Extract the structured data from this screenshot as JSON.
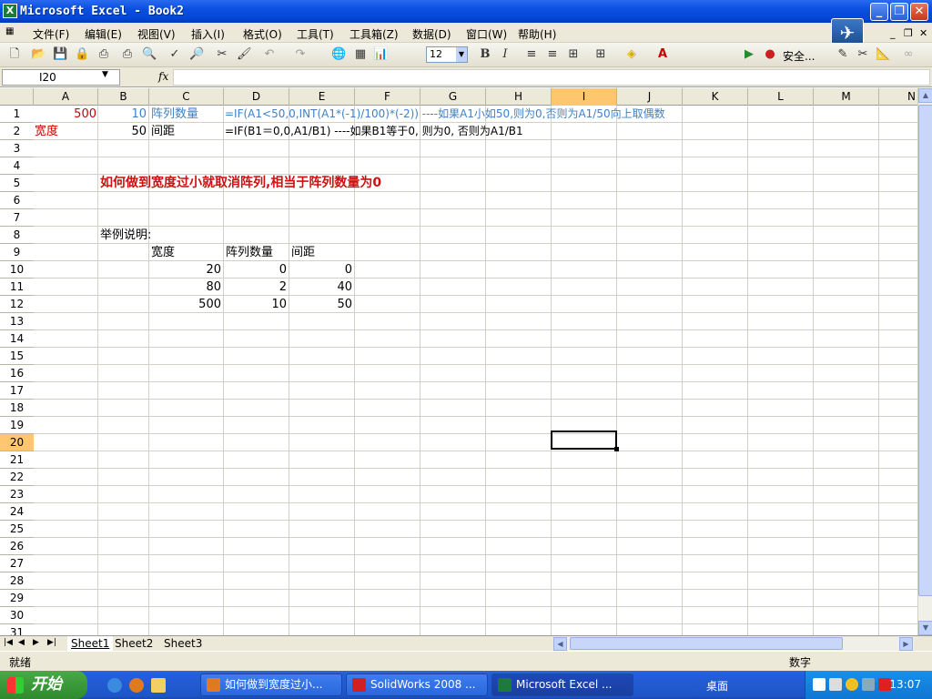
{
  "window": {
    "title": "Microsoft Excel - Book2"
  },
  "menu": [
    "文件(F)",
    "编辑(E)",
    "视图(V)",
    "插入(I)",
    "格式(O)",
    "工具(T)",
    "工具箱(Z)",
    "数据(D)",
    "窗口(W)",
    "帮助(H)"
  ],
  "toolbar": {
    "font_size": "12",
    "security_label": "安全..."
  },
  "formula_bar": {
    "name_box": "I20",
    "fx": "fx",
    "formula": ""
  },
  "columns": [
    "A",
    "B",
    "C",
    "D",
    "E",
    "F",
    "G",
    "H",
    "I",
    "J",
    "K",
    "L",
    "M",
    "N"
  ],
  "selected_column": "I",
  "selected_row": "20",
  "rows": [
    "1",
    "2",
    "3",
    "4",
    "5",
    "6",
    "7",
    "8",
    "9",
    "10",
    "11",
    "12",
    "13",
    "14",
    "15",
    "16",
    "17",
    "18",
    "19",
    "20",
    "21",
    "22",
    "23",
    "24",
    "25",
    "26",
    "27",
    "28",
    "29",
    "30",
    "31"
  ],
  "cells": {
    "a1": "500",
    "b1": "10",
    "c1": "阵列数量",
    "d1": "=IF(A1<50,0,INT(A1*(-1)/100)*(-2))   ----如果A1小如50,则为0,否则为A1/50向上取偶数",
    "a2": "宽度",
    "b2": "50",
    "c2": "间距",
    "d2": "=IF(B1＝0,0,A1/B1)    ----如果B1等于0, 则为0, 否则为A1/B1",
    "b5": "如何做到宽度过小就取消阵列,相当于阵列数量为0",
    "b8": "举例说明:",
    "c9": "宽度",
    "d9": "阵列数量",
    "e9": "间距",
    "c10": "20",
    "d10": "0",
    "e10": "0",
    "c11": "80",
    "d11": "2",
    "e11": "40",
    "c12": "500",
    "d12": "10",
    "e12": "50"
  },
  "sheets": [
    "Sheet1",
    "Sheet2",
    "Sheet3"
  ],
  "status": {
    "left": "就绪",
    "mode": "数字"
  },
  "taskbar": {
    "start": "开始",
    "buttons": [
      "如何做到宽度过小...",
      "SolidWorks 2008 ...",
      "Microsoft Excel ..."
    ],
    "desktop": "桌面",
    "clock": "13:07"
  }
}
